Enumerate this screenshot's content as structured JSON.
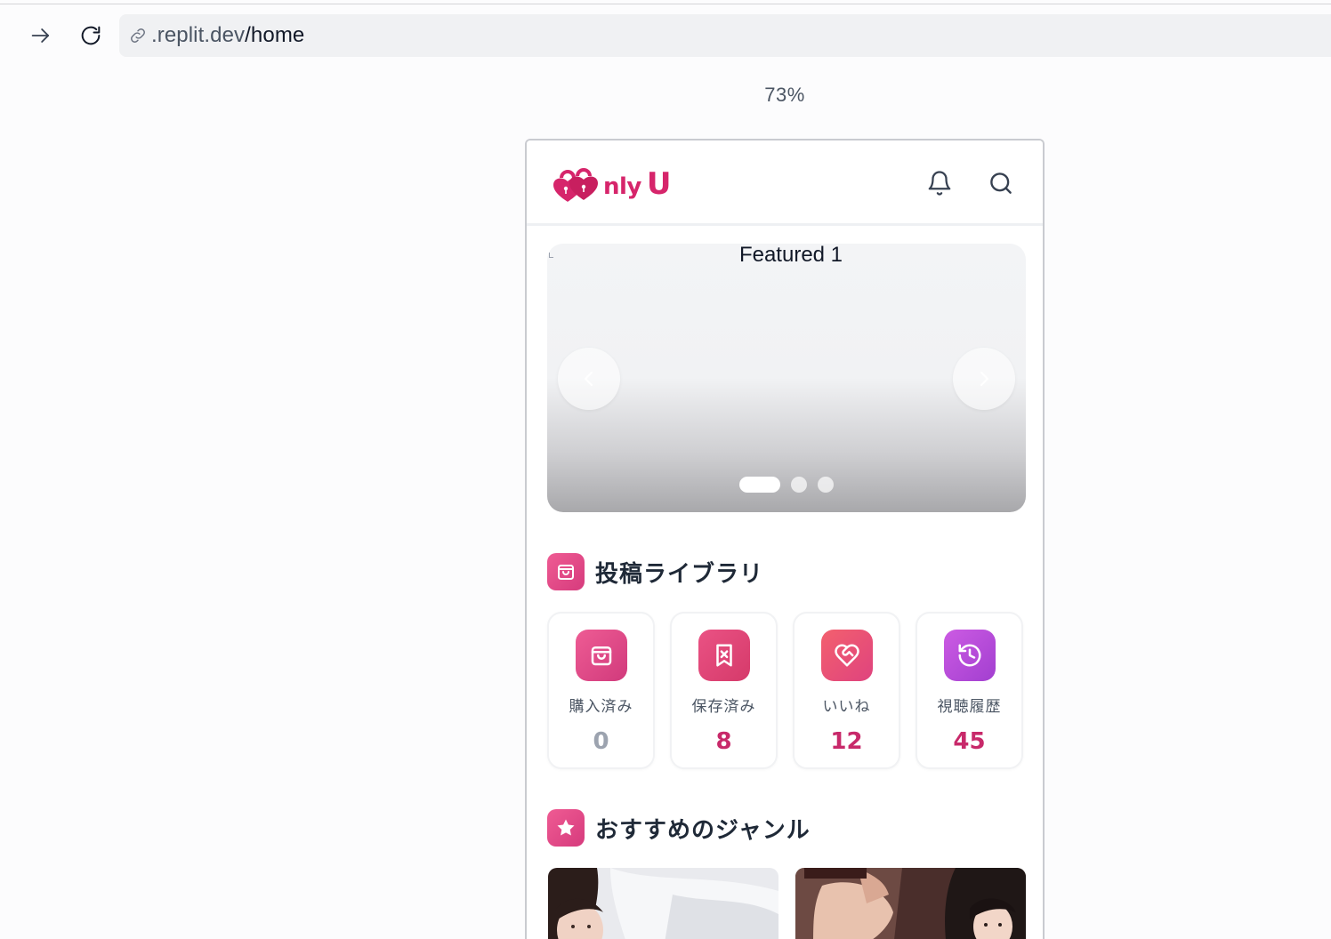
{
  "browser": {
    "url_host": ".replit.dev",
    "url_path": "/home",
    "zoom": "73%"
  },
  "app": {
    "logo_text": "nly",
    "logo_text_big": "U",
    "carousel": {
      "slide_title": "Featured 1",
      "slide_count": 3,
      "active_index": 0
    },
    "library": {
      "title": "投稿ライブラリ",
      "items": [
        {
          "label": "購入済み",
          "value": "0",
          "icon": "shopping-bag-icon",
          "gradient": [
            "#e9538f",
            "#d13a7c"
          ]
        },
        {
          "label": "保存済み",
          "value": "8",
          "icon": "bookmark-x-icon",
          "gradient": [
            "#e64b7a",
            "#d63a6a"
          ]
        },
        {
          "label": "いいね",
          "value": "12",
          "icon": "heart-handshake-icon",
          "gradient": [
            "#f0566d",
            "#e0447a"
          ]
        },
        {
          "label": "視聴履歴",
          "value": "45",
          "icon": "history-icon",
          "gradient": [
            "#c554e0",
            "#a33fd0"
          ]
        }
      ]
    },
    "genres": {
      "title": "おすすめのジャンル"
    }
  },
  "colors": {
    "brand": "#d6256b",
    "value_text": "#c8296a"
  }
}
